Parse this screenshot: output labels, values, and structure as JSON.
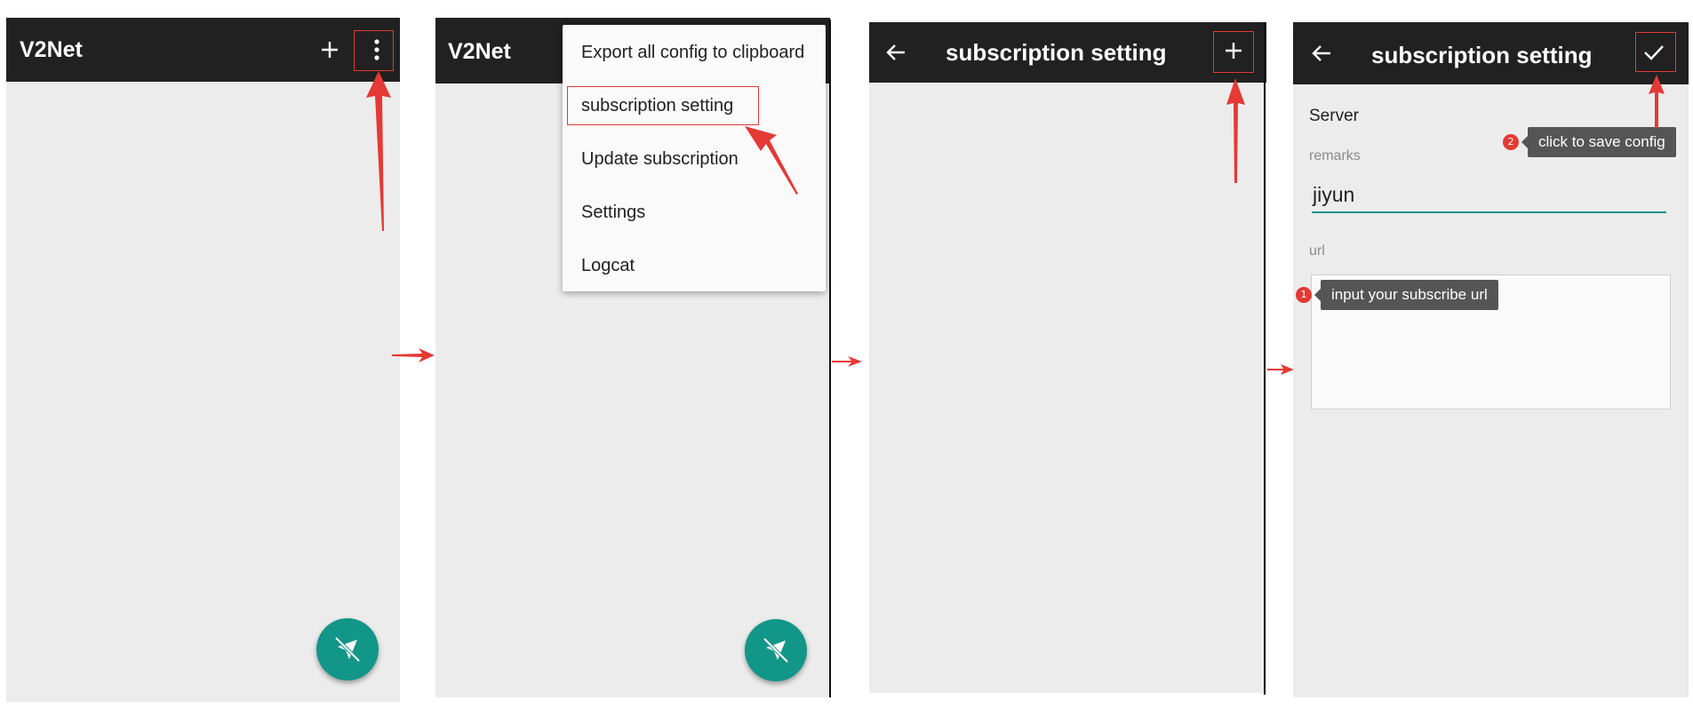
{
  "screen1": {
    "app_title": "V2Net",
    "add_icon": "plus-icon",
    "more_icon": "more-vert-icon",
    "fab_icon": "vpn-off-icon"
  },
  "screen2": {
    "app_title": "V2Net",
    "menu": [
      "Export all config to clipboard",
      "subscription setting",
      "Update subscription",
      "Settings",
      "Logcat"
    ],
    "highlighted_item": "subscription setting",
    "fab_icon": "vpn-off-icon"
  },
  "screen3": {
    "title": "subscription setting",
    "back_icon": "arrow-back-icon",
    "add_icon": "plus-icon"
  },
  "screen4": {
    "title": "subscription setting",
    "back_icon": "arrow-back-icon",
    "save_icon": "check-icon",
    "section_label": "Server",
    "remarks_label": "remarks",
    "remarks_value": "jiyun",
    "url_label": "url",
    "url_value": "",
    "annotation_1_number": "1",
    "annotation_1": "input your subscribe url",
    "annotation_2_number": "2",
    "annotation_2": "click to save config"
  },
  "colors": {
    "appbar": "#212121",
    "background": "#ececec",
    "accent": "#129688",
    "annotation_red": "#e53935",
    "tooltip": "#555555"
  }
}
